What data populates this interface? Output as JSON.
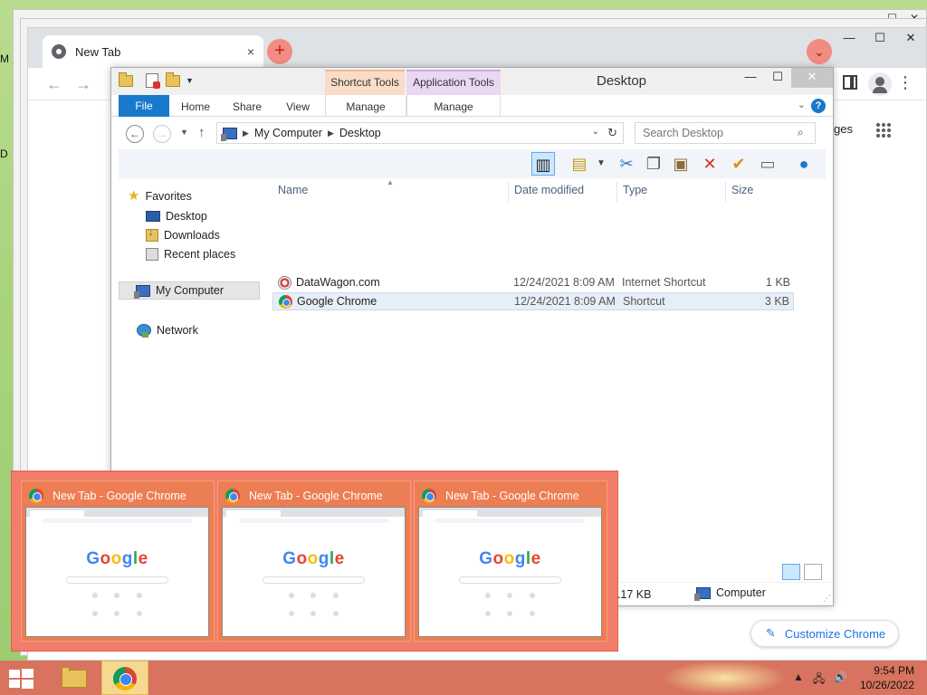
{
  "desktop": {
    "edge_letters": [
      "M",
      "D"
    ]
  },
  "chrome": {
    "tab_title": "New Tab",
    "tab_close": "×",
    "newtab": "+",
    "tab_search": "⌄",
    "min": "—",
    "max": "☐",
    "close": "✕",
    "back": "←",
    "forward": "→",
    "menu": "⋮",
    "images_partial": "ges",
    "customize_label": "Customize Chrome",
    "customize_icon": "✎"
  },
  "explorer": {
    "title": "Desktop",
    "context_tabs": {
      "shortcut_tools": "Shortcut Tools",
      "application_tools": "Application Tools"
    },
    "ribbon_tabs": [
      "File",
      "Home",
      "Share",
      "View"
    ],
    "manage_labels": [
      "Manage",
      "Manage"
    ],
    "address": [
      "My Computer",
      "Desktop"
    ],
    "search_placeholder": "Search Desktop",
    "nav": {
      "favorites": "Favorites",
      "fav_items": [
        "Desktop",
        "Downloads",
        "Recent places"
      ],
      "my_computer": "My Computer",
      "network": "Network"
    },
    "columns": [
      "Name",
      "Date modified",
      "Type",
      "Size"
    ],
    "files": [
      {
        "name": "DataWagon.com",
        "date": "12/24/2021 8:09 AM",
        "type": "Internet Shortcut",
        "size": "1 KB"
      },
      {
        "name": "Google Chrome",
        "date": "12/24/2021 8:09 AM",
        "type": "Shortcut",
        "size": "3 KB"
      }
    ],
    "status": {
      "size": "2.17 KB",
      "zone": "Computer"
    },
    "wctl": {
      "min": "—",
      "max": "☐",
      "close": "✕"
    }
  },
  "flyout": {
    "thumbnails": [
      {
        "title": "New Tab - Google Chrome"
      },
      {
        "title": "New Tab - Google Chrome"
      },
      {
        "title": "New Tab - Google Chrome"
      }
    ],
    "google_letters": [
      "G",
      "o",
      "o",
      "g",
      "l",
      "e"
    ]
  },
  "taskbar": {
    "time": "9:54 PM",
    "date": "10/26/2022",
    "tray_up": "▲",
    "tray_network": "🖧",
    "tray_volume": "🔊"
  },
  "colors": {
    "taskbar": "#d8735f",
    "flyout": "#f27d6a",
    "ribbon_file": "#1979ca",
    "shortcut_tools": "#f9dcc8",
    "application_tools": "#ead7f2"
  }
}
